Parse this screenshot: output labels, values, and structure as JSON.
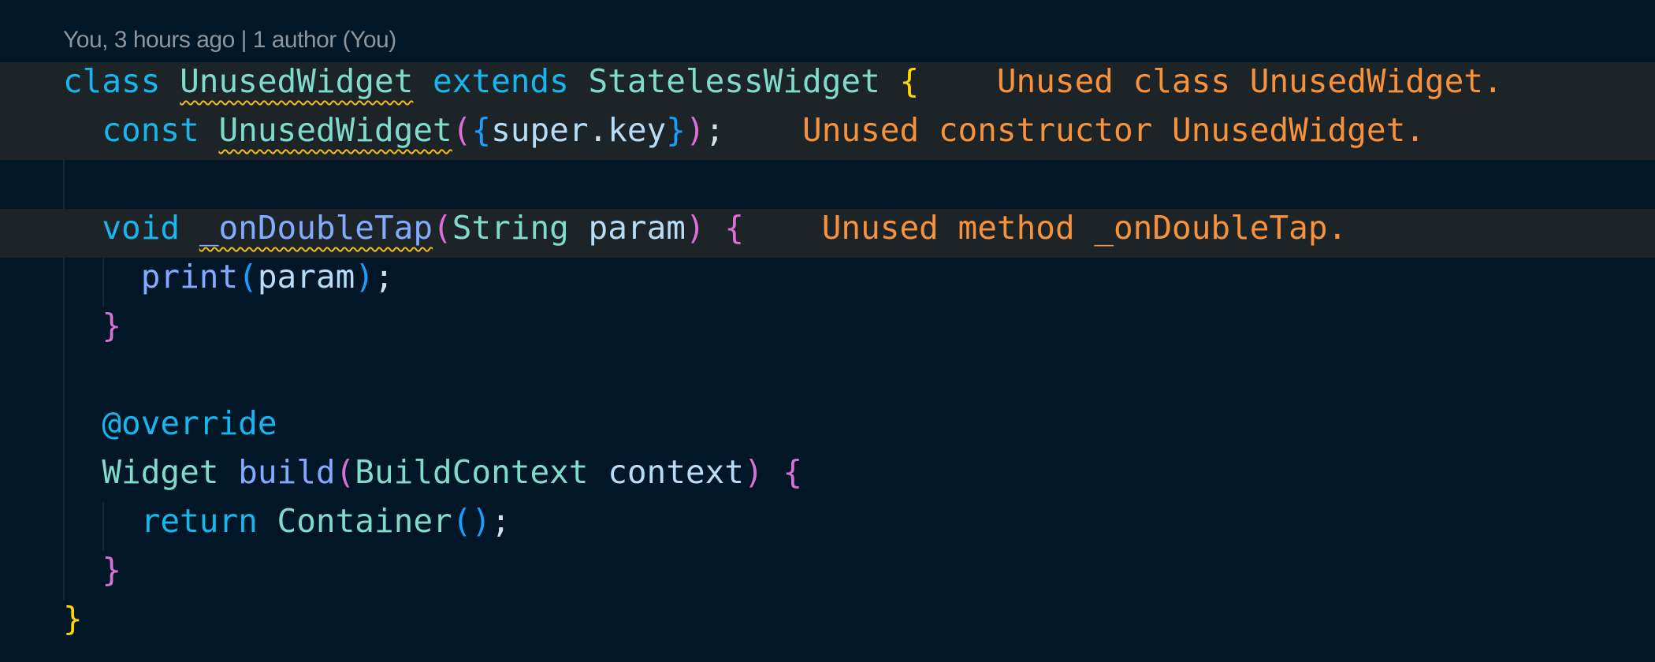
{
  "blame": "You, 3 hours ago | 1 author (You)",
  "colors": {
    "background": "#011627",
    "warning_squiggle": "#f2c012",
    "inline_message": "#f7913a",
    "line_highlight": "#1d2428"
  },
  "lines": [
    {
      "highlight": true,
      "tokens": [
        [
          "class",
          "kw"
        ],
        [
          " ",
          "plain"
        ],
        [
          "UnusedWidget",
          "type",
          true
        ],
        [
          " ",
          "plain"
        ],
        [
          "extends",
          "kw"
        ],
        [
          " ",
          "plain"
        ],
        [
          "StatelessWidget",
          "type"
        ],
        [
          " ",
          "plain"
        ],
        [
          "{",
          "brace1"
        ]
      ],
      "message": "Unused class UnusedWidget."
    },
    {
      "highlight": true,
      "tokens": [
        [
          "  ",
          "plain"
        ],
        [
          "const",
          "kw"
        ],
        [
          " ",
          "plain"
        ],
        [
          "UnusedWidget",
          "type",
          true
        ],
        [
          "(",
          "brace2"
        ],
        [
          "{",
          "brace3"
        ],
        [
          "super",
          "var"
        ],
        [
          ".",
          "punc"
        ],
        [
          "key",
          "var"
        ],
        [
          "}",
          "brace3"
        ],
        [
          ")",
          "brace2"
        ],
        [
          ";",
          "punc"
        ]
      ],
      "message": "Unused constructor UnusedWidget."
    },
    {
      "highlight": false,
      "tokens": []
    },
    {
      "highlight": true,
      "tokens": [
        [
          "  ",
          "plain"
        ],
        [
          "void",
          "kw"
        ],
        [
          " ",
          "plain"
        ],
        [
          "_onDoubleTap",
          "fn",
          true
        ],
        [
          "(",
          "brace2"
        ],
        [
          "String",
          "type"
        ],
        [
          " ",
          "plain"
        ],
        [
          "param",
          "var"
        ],
        [
          ")",
          "brace2"
        ],
        [
          " ",
          "plain"
        ],
        [
          "{",
          "brace2"
        ]
      ],
      "message": "Unused method _onDoubleTap."
    },
    {
      "highlight": false,
      "tokens": [
        [
          "    ",
          "plain"
        ],
        [
          "print",
          "fn"
        ],
        [
          "(",
          "brace3"
        ],
        [
          "param",
          "var"
        ],
        [
          ")",
          "brace3"
        ],
        [
          ";",
          "punc"
        ]
      ]
    },
    {
      "highlight": false,
      "tokens": [
        [
          "  ",
          "plain"
        ],
        [
          "}",
          "brace2"
        ]
      ]
    },
    {
      "highlight": false,
      "tokens": []
    },
    {
      "highlight": false,
      "tokens": [
        [
          "  ",
          "plain"
        ],
        [
          "@override",
          "kw"
        ]
      ]
    },
    {
      "highlight": false,
      "tokens": [
        [
          "  ",
          "plain"
        ],
        [
          "Widget",
          "type"
        ],
        [
          " ",
          "plain"
        ],
        [
          "build",
          "fn"
        ],
        [
          "(",
          "brace2"
        ],
        [
          "BuildContext",
          "type"
        ],
        [
          " ",
          "plain"
        ],
        [
          "context",
          "var"
        ],
        [
          ")",
          "brace2"
        ],
        [
          " ",
          "plain"
        ],
        [
          "{",
          "brace2"
        ]
      ]
    },
    {
      "highlight": false,
      "tokens": [
        [
          "    ",
          "plain"
        ],
        [
          "return",
          "kw"
        ],
        [
          " ",
          "plain"
        ],
        [
          "Container",
          "type"
        ],
        [
          "(",
          "brace3"
        ],
        [
          ")",
          "brace3"
        ],
        [
          ";",
          "punc"
        ]
      ]
    },
    {
      "highlight": false,
      "tokens": [
        [
          "  ",
          "plain"
        ],
        [
          "}",
          "brace2"
        ]
      ]
    },
    {
      "highlight": false,
      "tokens": [
        [
          "}",
          "brace1"
        ]
      ]
    }
  ]
}
